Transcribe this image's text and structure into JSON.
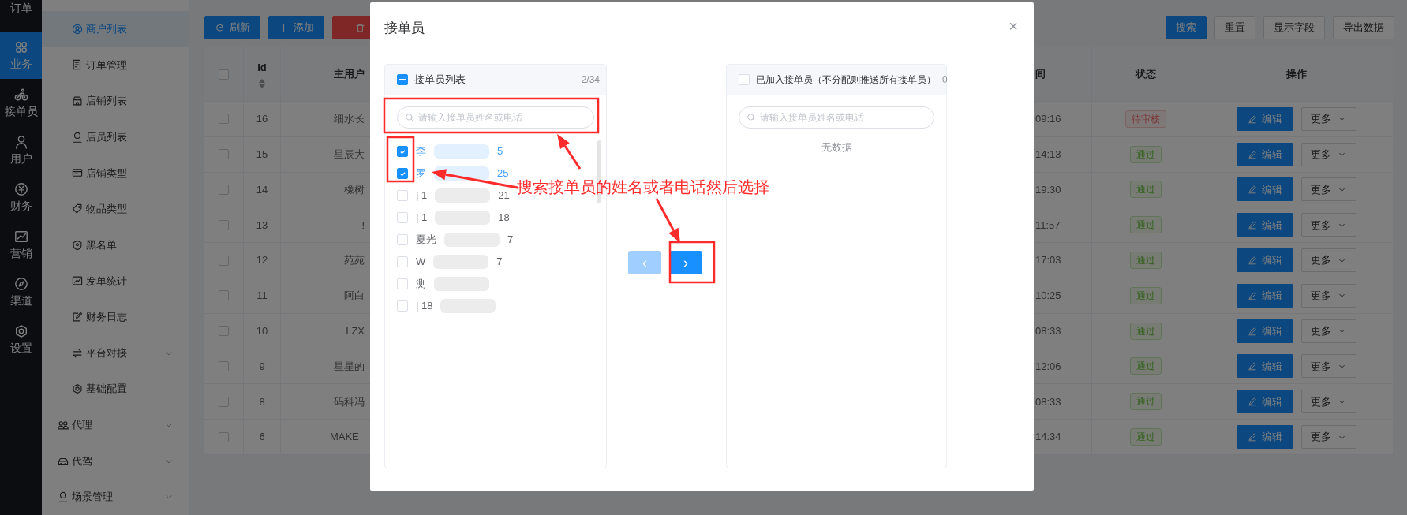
{
  "rail": [
    {
      "label": "订单",
      "selected": false
    },
    {
      "label": "业务",
      "selected": true
    },
    {
      "label": "接单员",
      "selected": false
    },
    {
      "label": "用户",
      "selected": false
    },
    {
      "label": "财务",
      "selected": false
    },
    {
      "label": "营销",
      "selected": false
    },
    {
      "label": "渠道",
      "selected": false
    },
    {
      "label": "设置",
      "selected": false
    }
  ],
  "submenu": [
    {
      "kind": "item",
      "label": "商户列表",
      "selected": true,
      "expandable": false
    },
    {
      "kind": "item",
      "label": "订单管理",
      "selected": false,
      "expandable": false
    },
    {
      "kind": "item",
      "label": "店铺列表",
      "selected": false,
      "expandable": false
    },
    {
      "kind": "item",
      "label": "店员列表",
      "selected": false,
      "expandable": false
    },
    {
      "kind": "item",
      "label": "店铺类型",
      "selected": false,
      "expandable": false
    },
    {
      "kind": "item",
      "label": "物品类型",
      "selected": false,
      "expandable": false
    },
    {
      "kind": "item",
      "label": "黑名单",
      "selected": false,
      "expandable": false
    },
    {
      "kind": "item",
      "label": "发单统计",
      "selected": false,
      "expandable": false
    },
    {
      "kind": "item",
      "label": "财务日志",
      "selected": false,
      "expandable": false
    },
    {
      "kind": "item",
      "label": "平台对接",
      "selected": false,
      "expandable": true
    },
    {
      "kind": "item",
      "label": "基础配置",
      "selected": false,
      "expandable": false
    },
    {
      "kind": "group",
      "label": "代理",
      "selected": false,
      "expandable": true
    },
    {
      "kind": "group",
      "label": "代驾",
      "selected": false,
      "expandable": true
    },
    {
      "kind": "group",
      "label": "场景管理",
      "selected": false,
      "expandable": true
    }
  ],
  "toolbar": {
    "left": [
      {
        "label": "刷新",
        "kind": "primary"
      },
      {
        "label": "添加",
        "kind": "primary"
      },
      {
        "kind": "danger"
      }
    ],
    "right": [
      {
        "label": "搜索",
        "kind": "primary"
      },
      {
        "label": "重置",
        "kind": "default"
      },
      {
        "label": "显示字段",
        "kind": "default"
      },
      {
        "label": "导出数据",
        "kind": "default"
      }
    ]
  },
  "table": {
    "select_all": false,
    "columns": [
      "Id",
      "主用户",
      "间",
      "状态",
      "操作"
    ],
    "rows": [
      {
        "checked": false,
        "id": "16",
        "user": "细水长",
        "time": "09:16",
        "status": {
          "text": "待审核",
          "kind": "pending"
        },
        "edit": "编辑",
        "more": "更多"
      },
      {
        "checked": false,
        "id": "15",
        "user": "星辰大",
        "time": "14:13",
        "status": {
          "text": "通过",
          "kind": "approved"
        },
        "edit": "编辑",
        "more": "更多"
      },
      {
        "checked": false,
        "id": "14",
        "user": "橡树",
        "time": "19:30",
        "status": {
          "text": "通过",
          "kind": "approved"
        },
        "edit": "编辑",
        "more": "更多"
      },
      {
        "checked": false,
        "id": "13",
        "user": "!",
        "time": "11:57",
        "status": {
          "text": "通过",
          "kind": "approved"
        },
        "edit": "编辑",
        "more": "更多"
      },
      {
        "checked": false,
        "id": "12",
        "user": "苑苑",
        "time": "17:03",
        "status": {
          "text": "通过",
          "kind": "approved"
        },
        "edit": "编辑",
        "more": "更多"
      },
      {
        "checked": false,
        "id": "11",
        "user": "阿白",
        "time": "10:25",
        "status": {
          "text": "通过",
          "kind": "approved"
        },
        "edit": "编辑",
        "more": "更多"
      },
      {
        "checked": false,
        "id": "10",
        "user": "LZX",
        "time": "08:33",
        "status": {
          "text": "通过",
          "kind": "approved"
        },
        "edit": "编辑",
        "more": "更多"
      },
      {
        "checked": false,
        "id": "9",
        "user": "星星的",
        "time": "12:06",
        "status": {
          "text": "通过",
          "kind": "approved"
        },
        "edit": "编辑",
        "more": "更多"
      },
      {
        "checked": false,
        "id": "8",
        "user": "码科冯",
        "time": "08:33",
        "status": {
          "text": "通过",
          "kind": "approved"
        },
        "edit": "编辑",
        "more": "更多"
      },
      {
        "checked": false,
        "id": "6",
        "user": "MAKE_",
        "time": "14:34",
        "status": {
          "text": "通过",
          "kind": "approved"
        },
        "edit": "编辑",
        "more": "更多"
      }
    ]
  },
  "dialog": {
    "title": "接单员",
    "close": "×",
    "source": {
      "title": "接单员列表",
      "count": "2/34",
      "indeterminate": true,
      "placeholder": "请输入接单员姓名或电话",
      "items": [
        {
          "label": "李",
          "tail": "5",
          "checked": true
        },
        {
          "label": "罗",
          "tail": "25",
          "checked": true
        },
        {
          "label": "| 1",
          "tail": "21",
          "checked": false
        },
        {
          "label": "| 1",
          "tail": "18",
          "checked": false
        },
        {
          "label": "夏光",
          "tail": "7",
          "checked": false
        },
        {
          "label": "W",
          "tail": "7",
          "checked": false
        },
        {
          "label": "测",
          "checked": false
        },
        {
          "label": "| 18",
          "checked": false
        }
      ]
    },
    "prev": {
      "label": "‹",
      "disabled": true
    },
    "next": {
      "label": "›",
      "disabled": false
    },
    "target": {
      "title": "已加入接单员（不分配则推送所有接单员）",
      "count": "0",
      "checked": false,
      "indeterminate": false,
      "placeholder": "请输入接单员姓名或电话",
      "empty": "无数据"
    }
  },
  "annotation": {
    "text": "搜索接单员的姓名或者电话然后选择"
  }
}
